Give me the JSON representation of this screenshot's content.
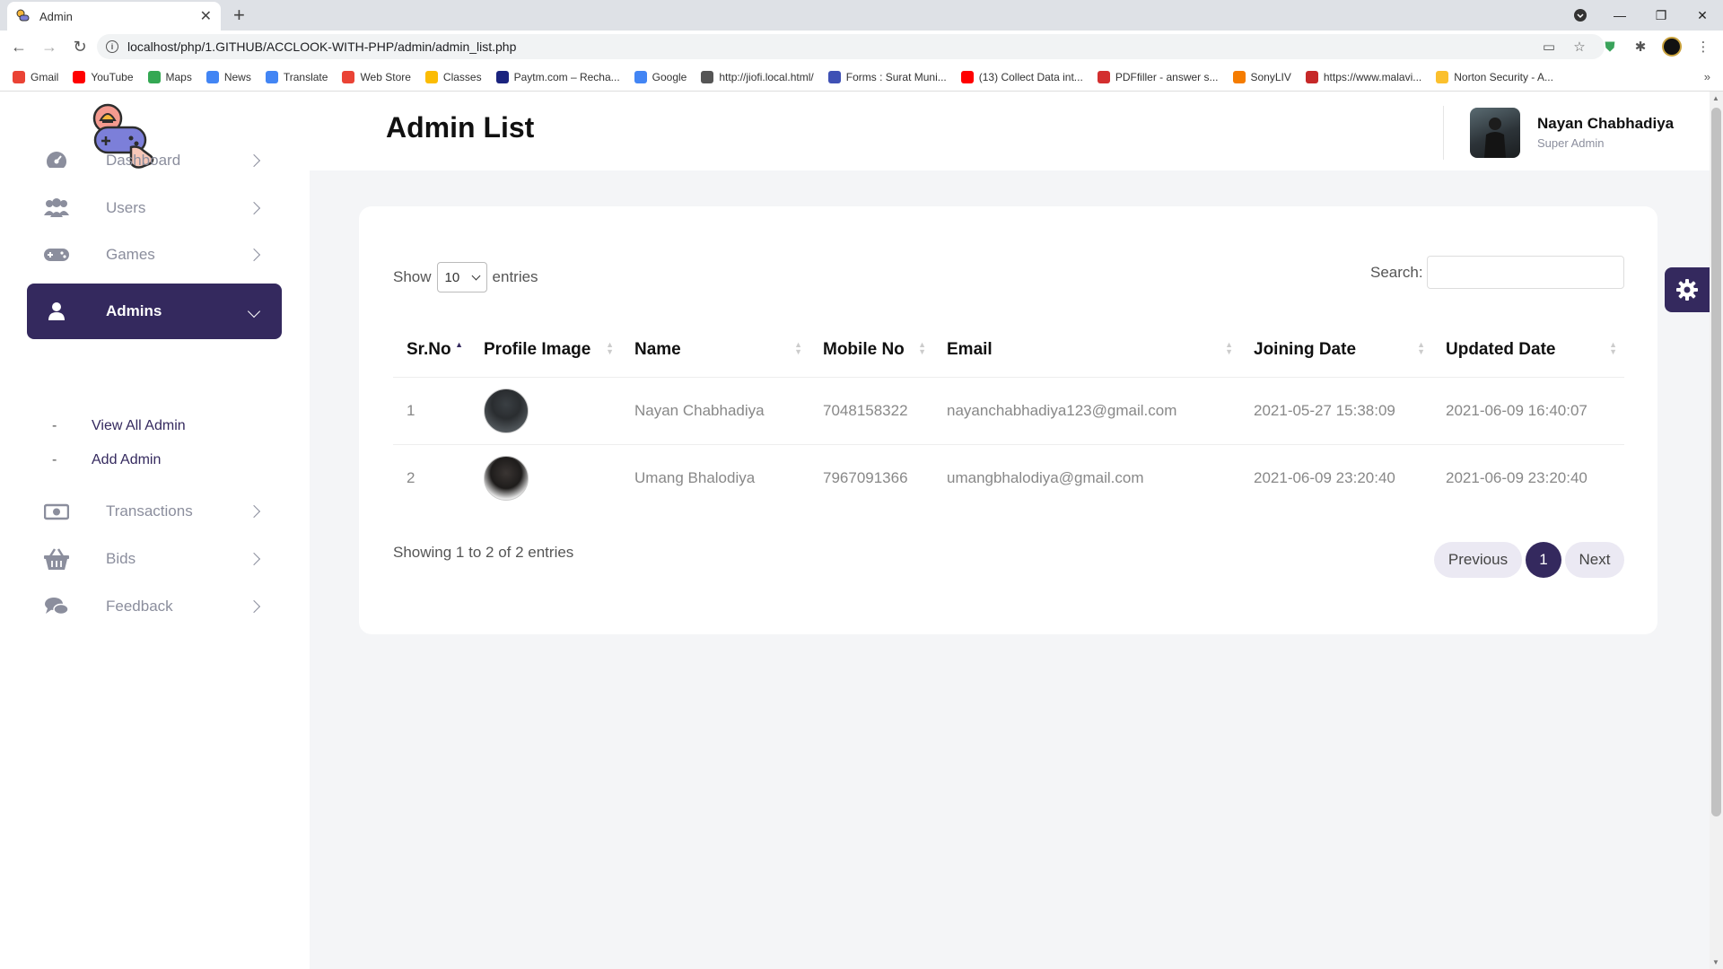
{
  "browser": {
    "tab_title": "Admin",
    "url": "localhost/php/1.GITHUB/ACCLOOK-WITH-PHP/admin/admin_list.php",
    "bookmarks": [
      {
        "label": "Gmail",
        "color": "#ea4335"
      },
      {
        "label": "YouTube",
        "color": "#ff0000"
      },
      {
        "label": "Maps",
        "color": "#34a853"
      },
      {
        "label": "News",
        "color": "#4285f4"
      },
      {
        "label": "Translate",
        "color": "#4285f4"
      },
      {
        "label": "Web Store",
        "color": "#ea4335"
      },
      {
        "label": "Classes",
        "color": "#fbbc04"
      },
      {
        "label": "Paytm.com – Recha...",
        "color": "#1a237e"
      },
      {
        "label": "Google",
        "color": "#4285f4"
      },
      {
        "label": "http://jiofi.local.html/",
        "color": "#555555"
      },
      {
        "label": "Forms : Surat Muni...",
        "color": "#3f51b5"
      },
      {
        "label": "(13) Collect Data int...",
        "color": "#ff0000"
      },
      {
        "label": "PDFfiller - answer s...",
        "color": "#d32f2f"
      },
      {
        "label": "SonyLIV",
        "color": "#f57c00"
      },
      {
        "label": "https://www.malavi...",
        "color": "#c62828"
      },
      {
        "label": "Norton Security - A...",
        "color": "#fbc02d"
      }
    ]
  },
  "sidebar": {
    "items": [
      {
        "label": "Dashboard",
        "icon": "palette-icon"
      },
      {
        "label": "Users",
        "icon": "users-icon"
      },
      {
        "label": "Games",
        "icon": "gamepad-icon"
      },
      {
        "label": "Admins",
        "icon": "user-icon"
      },
      {
        "label": "Transactions",
        "icon": "money-icon"
      },
      {
        "label": "Bids",
        "icon": "basket-icon"
      },
      {
        "label": "Feedback",
        "icon": "comments-icon"
      }
    ],
    "sub_items": [
      {
        "label": "View All Admin"
      },
      {
        "label": "Add Admin"
      }
    ],
    "sub_dash": "-"
  },
  "header": {
    "title": "Admin List",
    "user_name": "Nayan Chabhadiya",
    "user_role": "Super Admin"
  },
  "table_controls": {
    "show_label": "Show",
    "entries_value": "10",
    "entries_label": "entries",
    "search_label": "Search:"
  },
  "table": {
    "columns": [
      "Sr.No",
      "Profile Image",
      "Name",
      "Mobile No",
      "Email",
      "Joining Date",
      "Updated Date"
    ],
    "rows": [
      {
        "sr": "1",
        "name": "Nayan Chabhadiya",
        "mobile": "7048158322",
        "email": "nayanchabhadiya123@gmail.com",
        "joined": "2021-05-27 15:38:09",
        "updated": "2021-06-09 16:40:07"
      },
      {
        "sr": "2",
        "name": "Umang Bhalodiya",
        "mobile": "7967091366",
        "email": "umangbhalodiya@gmail.com",
        "joined": "2021-06-09 23:20:40",
        "updated": "2021-06-09 23:20:40"
      }
    ]
  },
  "pagination": {
    "info": "Showing 1 to 2 of 2 entries",
    "previous": "Previous",
    "current": "1",
    "next": "Next"
  },
  "colors": {
    "accent": "#34295e",
    "muted_text": "#8b8e9d"
  }
}
